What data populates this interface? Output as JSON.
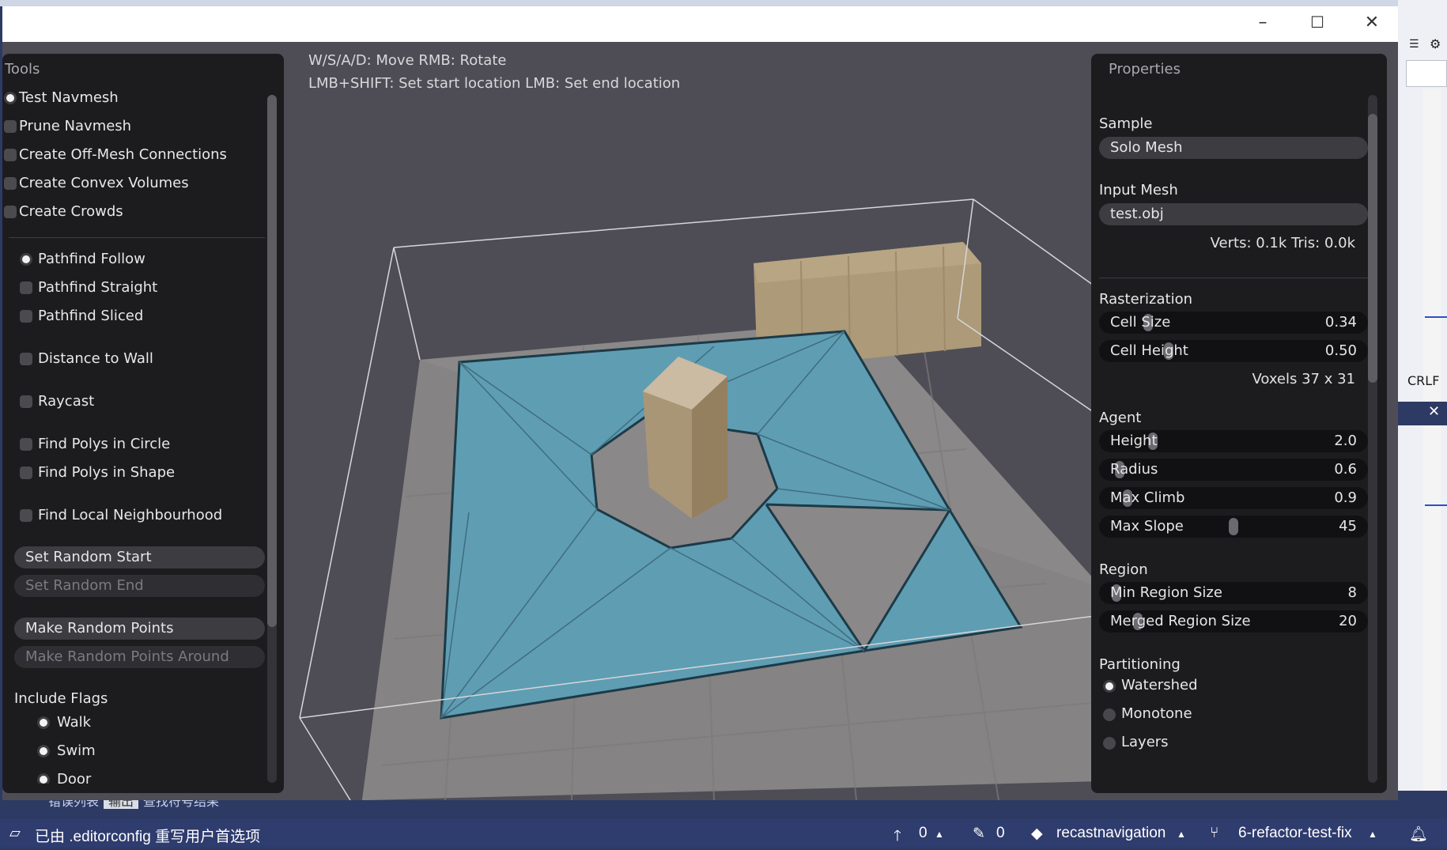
{
  "hints": {
    "line1": "W/S/A/D: Move  RMB: Rotate",
    "line2": "LMB+SHIFT: Set start location  LMB: Set end location"
  },
  "tools": {
    "title": "Tools",
    "tool_items": [
      {
        "label": "Test Navmesh",
        "selected": true
      },
      {
        "label": "Prune Navmesh",
        "selected": false
      },
      {
        "label": "Create Off-Mesh Connections",
        "selected": false
      },
      {
        "label": "Create Convex Volumes",
        "selected": false
      },
      {
        "label": "Create Crowds",
        "selected": false
      }
    ],
    "modes": [
      {
        "label": "Pathfind Follow",
        "selected": true
      },
      {
        "label": "Pathfind Straight",
        "selected": false
      },
      {
        "label": "Pathfind Sliced",
        "selected": false
      },
      {
        "label": "Distance to Wall",
        "selected": false
      },
      {
        "label": "Raycast",
        "selected": false
      },
      {
        "label": "Find Polys in Circle",
        "selected": false
      },
      {
        "label": "Find Polys in Shape",
        "selected": false
      },
      {
        "label": "Find Local Neighbourhood",
        "selected": false
      }
    ],
    "buttons": {
      "set_random_start": "Set Random Start",
      "set_random_end": "Set Random End",
      "make_random_points": "Make Random Points",
      "make_random_points_around": "Make Random Points Around"
    },
    "include_flags": {
      "title": "Include Flags",
      "walk": "Walk",
      "swim": "Swim",
      "door": "Door"
    }
  },
  "properties": {
    "title": "Properties",
    "sample": {
      "label": "Sample",
      "value": "Solo Mesh"
    },
    "input_mesh": {
      "label": "Input Mesh",
      "value": "test.obj",
      "info": "Verts: 0.1k  Tris: 0.0k"
    },
    "rasterization": {
      "label": "Rasterization",
      "cell_size": {
        "label": "Cell Size",
        "value": "0.34",
        "fraction": 0.17
      },
      "cell_height": {
        "label": "Cell Height",
        "value": "0.50",
        "fraction": 0.25
      },
      "voxels": "Voxels  37 x 31"
    },
    "agent": {
      "label": "Agent",
      "height": {
        "label": "Height",
        "value": "2.0",
        "fraction": 0.19
      },
      "radius": {
        "label": "Radius",
        "value": "0.6",
        "fraction": 0.06
      },
      "max_climb": {
        "label": "Max Climb",
        "value": "0.9",
        "fraction": 0.09
      },
      "max_slope": {
        "label": "Max Slope",
        "value": "45",
        "fraction": 0.5
      }
    },
    "region": {
      "label": "Region",
      "min_region_size": {
        "label": "Min Region Size",
        "value": "8",
        "fraction": 0.05
      },
      "merged_region_size": {
        "label": "Merged Region Size",
        "value": "20",
        "fraction": 0.13
      }
    },
    "partitioning": {
      "label": "Partitioning",
      "watershed": {
        "label": "Watershed",
        "selected": true
      },
      "monotone": {
        "label": "Monotone",
        "selected": false
      },
      "layers": {
        "label": "Layers",
        "selected": false
      }
    }
  },
  "ide": {
    "bottom_tabs": [
      "错误列表",
      "输出",
      "查找符号结果"
    ],
    "crlf": "CRLF",
    "status": {
      "message": "已由 .editorconfig 重写用户首选项",
      "push_count": "0",
      "edit_count": "0",
      "repo": "recastnavigation",
      "branch": "6-refactor-test-fix"
    }
  }
}
